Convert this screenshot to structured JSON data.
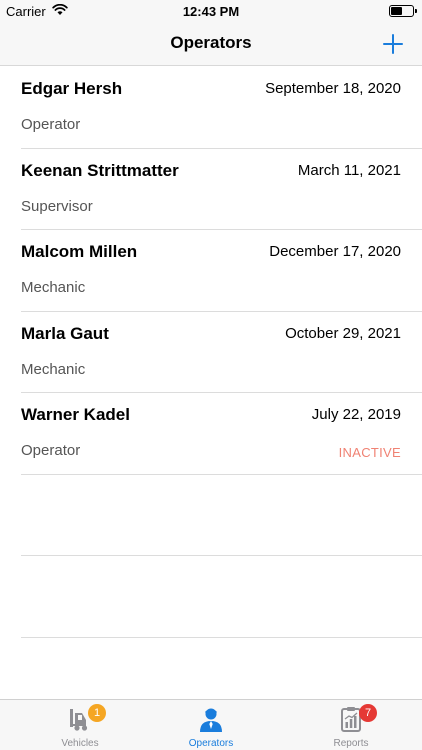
{
  "status_bar": {
    "carrier": "Carrier",
    "time": "12:43 PM"
  },
  "nav": {
    "title": "Operators"
  },
  "operators": [
    {
      "name": "Edgar Hersh",
      "date": "September 18, 2020",
      "role": "Operator",
      "status": ""
    },
    {
      "name": "Keenan Strittmatter",
      "date": "March 11, 2021",
      "role": "Supervisor",
      "status": ""
    },
    {
      "name": "Malcom Millen",
      "date": "December 17, 2020",
      "role": "Mechanic",
      "status": ""
    },
    {
      "name": "Marla Gaut",
      "date": "October 29, 2021",
      "role": "Mechanic",
      "status": ""
    },
    {
      "name": "Warner Kadel",
      "date": "July 22, 2019",
      "role": "Operator",
      "status": "INACTIVE"
    }
  ],
  "tabs": [
    {
      "label": "Vehicles",
      "icon": "forklift-icon",
      "badge": "1",
      "badge_color": "#f5a623"
    },
    {
      "label": "Operators",
      "icon": "person-icon",
      "badge": "",
      "badge_color": ""
    },
    {
      "label": "Reports",
      "icon": "clipboard-chart-icon",
      "badge": "7",
      "badge_color": "#e53935"
    }
  ],
  "colors": {
    "accent": "#1a7ddc",
    "inactive": "#f08273",
    "tab_inactive": "#8e8e93"
  }
}
